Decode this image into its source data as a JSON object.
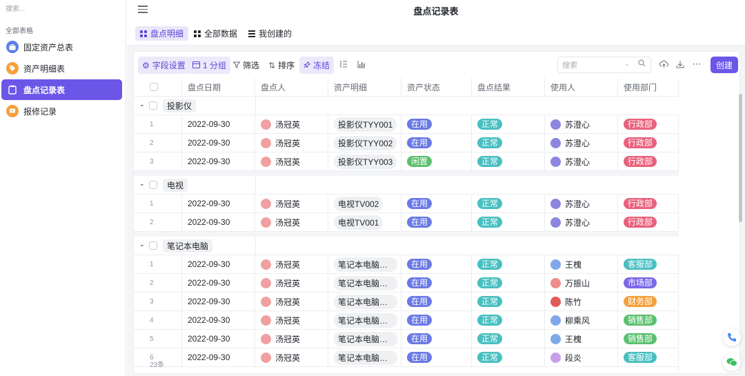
{
  "sidebar": {
    "search_placeholder": "搜索...",
    "section": "全部表格",
    "items": [
      {
        "label": "固定资产总表",
        "icon": "briefcase-icon",
        "color": "#5b7fe8"
      },
      {
        "label": "资产明细表",
        "icon": "tag-icon",
        "color": "#f5a03a"
      },
      {
        "label": "盘点记录表",
        "icon": "clipboard-icon",
        "color": "#ffffff"
      },
      {
        "label": "报修记录",
        "icon": "message-icon",
        "color": "#f5a03a"
      }
    ]
  },
  "header": {
    "title": "盘点记录表"
  },
  "views": [
    {
      "label": "盘点明细",
      "icon": "grid-icon"
    },
    {
      "label": "全部数据",
      "icon": "grid-icon"
    },
    {
      "label": "我创建的",
      "icon": "list-icon"
    }
  ],
  "toolbar": {
    "field_settings": "字段设置",
    "group": "1 分组",
    "filter": "筛选",
    "sort": "排序",
    "freeze": "冻结",
    "search_placeholder": "搜索",
    "create": "创建"
  },
  "columns": [
    "盘点日期",
    "盘点人",
    "资产明细",
    "资产状态",
    "盘点结果",
    "使用人",
    "使用部门"
  ],
  "groups": [
    {
      "name": "投影仪",
      "rows": [
        {
          "idx": "1",
          "date": "2022-09-30",
          "person": "汤冠英",
          "asset": "投影仪TYY001",
          "status": "在用",
          "result": "正常",
          "user": "苏澄心",
          "dept": "行政部"
        },
        {
          "idx": "2",
          "date": "2022-09-30",
          "person": "汤冠英",
          "asset": "投影仪TYY002",
          "status": "在用",
          "result": "正常",
          "user": "苏澄心",
          "dept": "行政部"
        },
        {
          "idx": "3",
          "date": "2022-09-30",
          "person": "汤冠英",
          "asset": "投影仪TYY003",
          "status": "闲置",
          "result": "正常",
          "user": "苏澄心",
          "dept": "行政部"
        }
      ]
    },
    {
      "name": "电视",
      "rows": [
        {
          "idx": "1",
          "date": "2022-09-30",
          "person": "汤冠英",
          "asset": "电视TV002",
          "status": "在用",
          "result": "正常",
          "user": "苏澄心",
          "dept": "行政部"
        },
        {
          "idx": "2",
          "date": "2022-09-30",
          "person": "汤冠英",
          "asset": "电视TV001",
          "status": "在用",
          "result": "正常",
          "user": "苏澄心",
          "dept": "行政部"
        }
      ]
    },
    {
      "name": "笔记本电脑",
      "rows": [
        {
          "idx": "1",
          "date": "2022-09-30",
          "person": "汤冠英",
          "asset": "笔记本电脑Not...",
          "status": "在用",
          "result": "正常",
          "user": "王槐",
          "dept": "客服部"
        },
        {
          "idx": "2",
          "date": "2022-09-30",
          "person": "汤冠英",
          "asset": "笔记本电脑Not...",
          "status": "在用",
          "result": "正常",
          "user": "万振山",
          "dept": "市场部"
        },
        {
          "idx": "3",
          "date": "2022-09-30",
          "person": "汤冠英",
          "asset": "笔记本电脑Not...",
          "status": "在用",
          "result": "正常",
          "user": "陈竹",
          "dept": "财务部"
        },
        {
          "idx": "4",
          "date": "2022-09-30",
          "person": "汤冠英",
          "asset": "笔记本电脑Not...",
          "status": "在用",
          "result": "正常",
          "user": "柳乘风",
          "dept": "销售部"
        },
        {
          "idx": "5",
          "date": "2022-09-30",
          "person": "汤冠英",
          "asset": "笔记本电脑Not...",
          "status": "在用",
          "result": "正常",
          "user": "王槐",
          "dept": "销售部"
        },
        {
          "idx": "6",
          "date": "2022-09-30",
          "person": "汤冠英",
          "asset": "笔记本电脑Not...",
          "status": "在用",
          "result": "正常",
          "user": "段炎",
          "dept": "客服部"
        }
      ]
    }
  ],
  "footer": {
    "count": "23条"
  },
  "colors": {
    "accent": "#6b56e8",
    "status_in_use": "#6979e6",
    "status_idle": "#5cc06f",
    "result_normal": "#48bfc0",
    "dept_admin": "#e9617c",
    "dept_service": "#48bfc0",
    "dept_market": "#7a67e8",
    "dept_finance": "#f5a03a",
    "dept_sales": "#5cc06f"
  }
}
